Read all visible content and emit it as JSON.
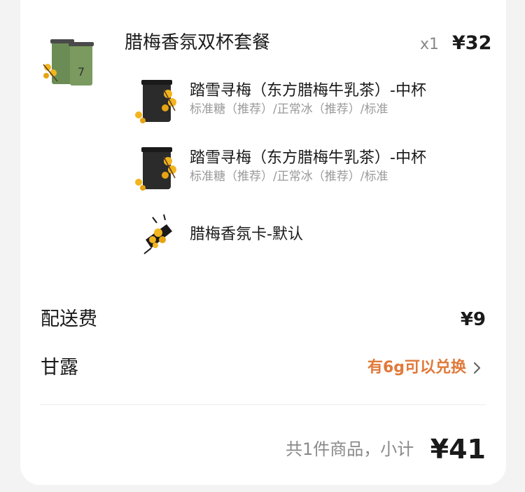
{
  "combo": {
    "name": "腊梅香氛双杯套餐",
    "quantity": "x1",
    "price": "¥32",
    "items": [
      {
        "name": "踏雪寻梅（东方腊梅牛乳茶）-中杯",
        "spec": "标准糖（推荐）/正常冰（推荐）/标准"
      },
      {
        "name": "踏雪寻梅（东方腊梅牛乳茶）-中杯",
        "spec": "标准糖（推荐）/正常冰（推荐）/标准"
      },
      {
        "name": "腊梅香氛卡-默认",
        "spec": ""
      }
    ],
    "cup_label": "7"
  },
  "delivery": {
    "label": "配送费",
    "value": "¥9"
  },
  "points": {
    "label": "甘露",
    "value": "有6g可以兑换"
  },
  "summary": {
    "count_text": "共1件商品，小计",
    "total": "¥41"
  },
  "colors": {
    "accent": "#e0793a",
    "cup_green": "#6b8d55",
    "cup_dark": "#2b2b2b",
    "flower": "#f2b51f"
  }
}
